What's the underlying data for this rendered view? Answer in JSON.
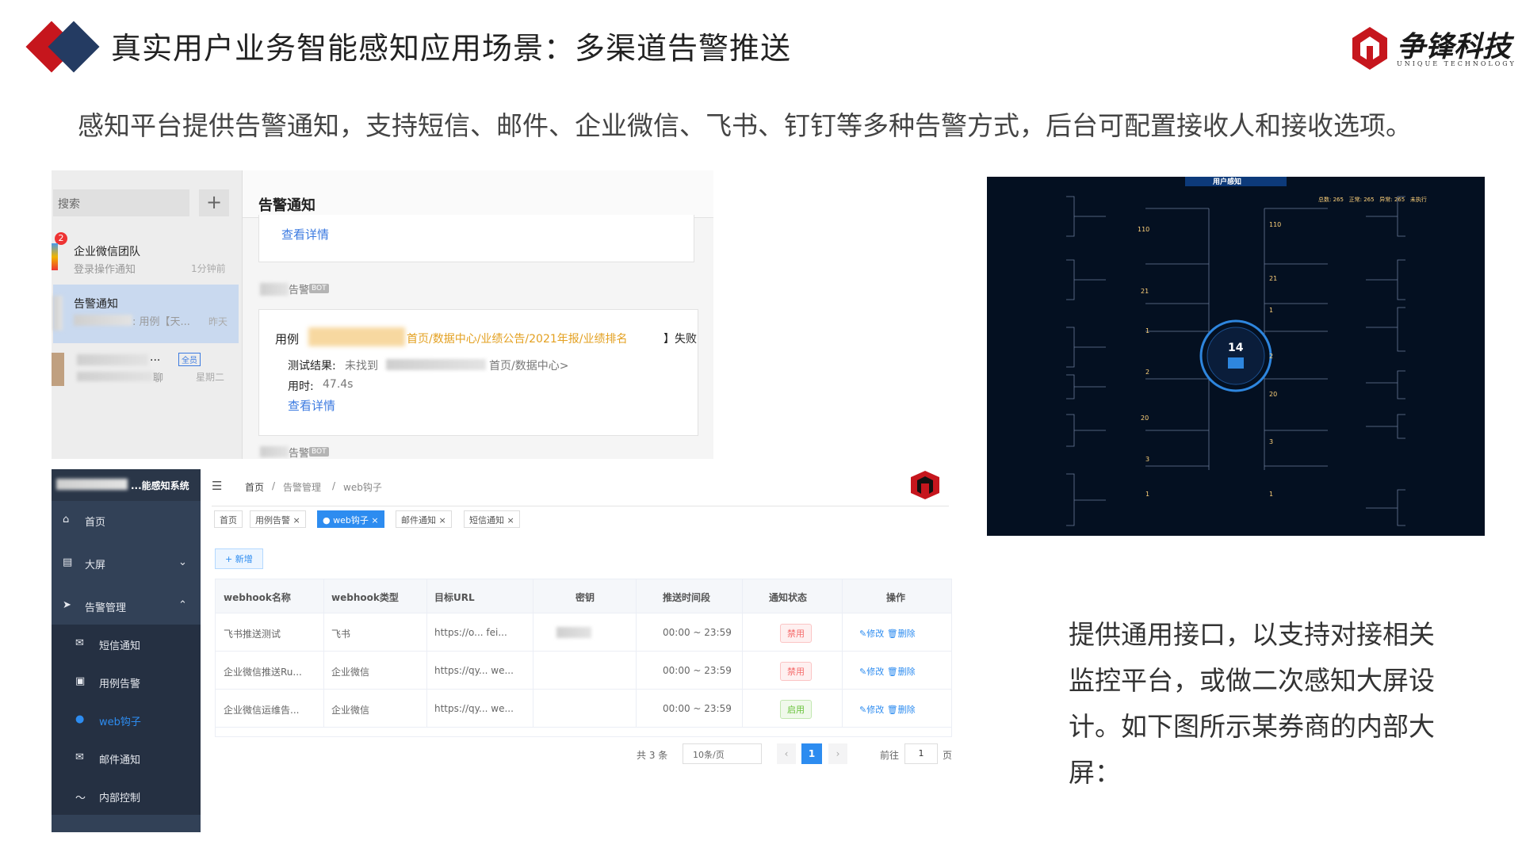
{
  "header": {
    "title": "真实用户业务智能感知应用场景：多渠道告警推送",
    "logo_cn": "争锋科技",
    "logo_en": "UNIQUE TECHNOLOGY"
  },
  "subtitle": "感知平台提供告警通知，支持短信、邮件、企业微信、飞书、钉钉等多种告警方式，后台可配置接收人和接收选项。",
  "description": "提供通用接口，以支持对接相关监控平台，或做二次感知大屏设计。如下图所示某券商的内部大屏：",
  "chat": {
    "search_placeholder": "搜索",
    "plus": "+",
    "badge": "2",
    "items": [
      {
        "name": "企业微信团队",
        "sub": "登录操作通知",
        "time": "1分钟前"
      },
      {
        "name": "告警通知",
        "sub": ": 用例【天...",
        "time": "昨天"
      },
      {
        "name": "...",
        "sub": "聊",
        "time": "星期二",
        "tag": "全员"
      }
    ],
    "panel_title": "告警通知",
    "link1": "查看详情",
    "msg_label": "告警",
    "bot": "BOT",
    "case_label": "用例",
    "case_path": "首页/数据中心/业绩公告/2021年报/业绩排名",
    "case_status": "】失败",
    "result_label": "测试结果:",
    "result_text": "未找到",
    "result_path": "首页/数据中心>",
    "time_label": "用时:",
    "time_value": "47.4s",
    "link2": "查看详情",
    "msg_label2": "告警",
    "bot2": "BOT"
  },
  "admin": {
    "system_name": "...能感知系统",
    "menu": [
      {
        "icon": "dashboard-icon",
        "label": "首页"
      },
      {
        "icon": "screen-icon",
        "label": "大屏"
      },
      {
        "icon": "bell-icon",
        "label": "告警管理"
      }
    ],
    "submenu": [
      {
        "icon": "mail-icon",
        "label": "短信通知"
      },
      {
        "icon": "case-icon",
        "label": "用例告警"
      },
      {
        "icon": "webhook-icon",
        "label": "web钩子"
      },
      {
        "icon": "mail-icon",
        "label": "邮件通知"
      },
      {
        "icon": "control-icon",
        "label": "内部控制"
      }
    ],
    "breadcrumb": [
      "首页",
      "/",
      "告警管理",
      "/",
      "web钩子"
    ],
    "tabs": [
      "首页",
      "用例告警 ×",
      "● web钩子 ×",
      "邮件通知 ×",
      "短信通知 ×"
    ],
    "add_button": "+ 新增",
    "columns": [
      "webhook名称",
      "webhook类型",
      "目标URL",
      "密钥",
      "推送时间段",
      "通知状态",
      "操作"
    ],
    "rows": [
      {
        "name": "飞书推送测试",
        "type": "飞书",
        "url": "https://o... fei...",
        "time": "00:00 ~ 23:59",
        "status": "禁用",
        "ops": "✎修改 🗑删除"
      },
      {
        "name": "企业微信推送Ru...",
        "type": "企业微信",
        "url": "https://qy... we...",
        "time": "00:00 ~ 23:59",
        "status": "禁用",
        "ops": "✎修改 🗑删除"
      },
      {
        "name": "企业微信运维告...",
        "type": "企业微信",
        "url": "https://qy... we...",
        "time": "00:00 ~ 23:59",
        "status": "启用",
        "ops": "✎修改 🗑删除"
      }
    ],
    "pager": {
      "total": "共 3 条",
      "size": "10条/页",
      "current": "1",
      "goto": "前往",
      "page": "1",
      "unit": "页"
    }
  },
  "dashboard": {
    "title": "用户感知",
    "center": "14",
    "left_nodes": [
      "110",
      "21",
      "1",
      "2",
      "20",
      "3",
      "1"
    ],
    "right_nodes": [
      "110",
      "21",
      "1",
      "2",
      "20",
      "3",
      "1"
    ],
    "top_stats": "总数: 265   正常: 265   异常: 265   未执行"
  }
}
